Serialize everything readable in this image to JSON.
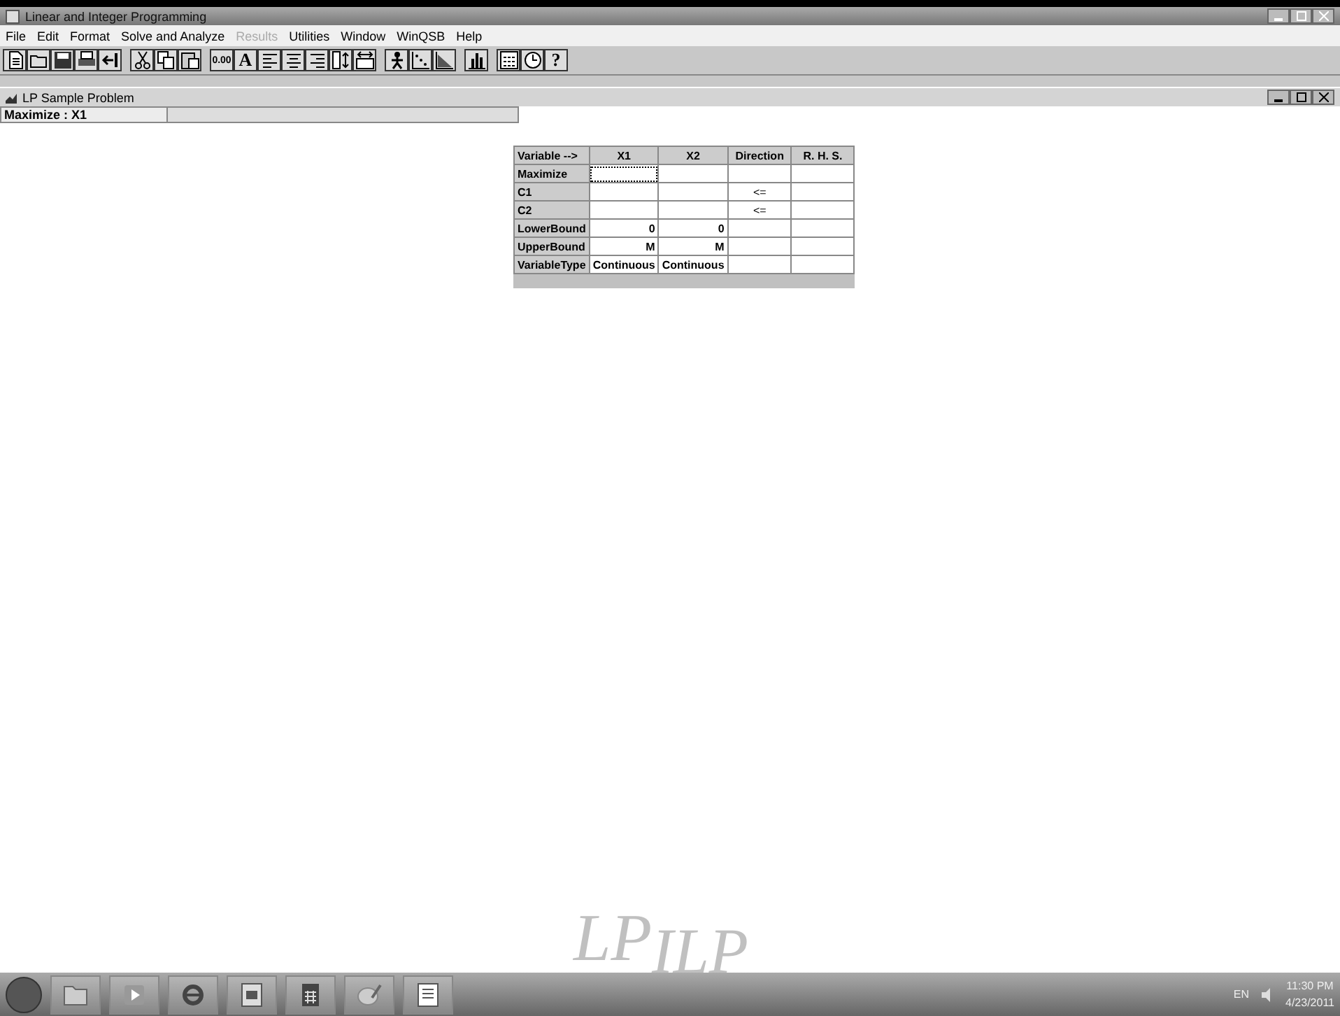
{
  "window": {
    "title": "Linear and Integer Programming"
  },
  "menu": [
    {
      "label": "File",
      "disabled": false
    },
    {
      "label": "Edit",
      "disabled": false
    },
    {
      "label": "Format",
      "disabled": false
    },
    {
      "label": "Solve and Analyze",
      "disabled": false
    },
    {
      "label": "Results",
      "disabled": true
    },
    {
      "label": "Utilities",
      "disabled": false
    },
    {
      "label": "Window",
      "disabled": false
    },
    {
      "label": "WinQSB",
      "disabled": false
    },
    {
      "label": "Help",
      "disabled": false
    }
  ],
  "toolbar": [
    [
      {
        "kind": "new"
      },
      {
        "kind": "open"
      },
      {
        "kind": "save"
      },
      {
        "kind": "print"
      },
      {
        "kind": "exit"
      }
    ],
    [
      {
        "kind": "cut"
      },
      {
        "kind": "copy"
      },
      {
        "kind": "paste"
      }
    ],
    [
      {
        "kind": "text",
        "label": "0.00"
      },
      {
        "kind": "font",
        "label": "A"
      },
      {
        "kind": "left"
      },
      {
        "kind": "center"
      },
      {
        "kind": "right"
      },
      {
        "kind": "height"
      },
      {
        "kind": "width"
      }
    ],
    [
      {
        "kind": "solve"
      },
      {
        "kind": "points"
      },
      {
        "kind": "area"
      }
    ],
    [
      {
        "kind": "bars"
      }
    ],
    [
      {
        "kind": "calc"
      },
      {
        "kind": "clock"
      },
      {
        "kind": "help",
        "label": "?"
      }
    ]
  ],
  "child_window": {
    "title": "LP Sample Problem",
    "objective": "Maximize : X1"
  },
  "table": {
    "columns": [
      "Variable -->",
      "X1",
      "X2",
      "Direction",
      "R. H. S."
    ],
    "rows": [
      {
        "cells": [
          {
            "text": "Maximize",
            "selected": false
          },
          {
            "selected": true
          },
          {
            "selected": false
          },
          {
            "selected": false
          },
          {
            "selected": false
          }
        ]
      },
      {
        "cells": [
          {
            "text": "C1",
            "selected": false
          },
          {
            "selected": false
          },
          {
            "selected": false
          },
          {
            "text": "<=",
            "selected": false
          },
          {
            "selected": false
          }
        ]
      },
      {
        "cells": [
          {
            "text": "C2",
            "selected": false
          },
          {
            "selected": false
          },
          {
            "selected": false
          },
          {
            "text": "<=",
            "selected": false
          },
          {
            "selected": false
          }
        ]
      },
      {
        "cells": [
          {
            "text": "LowerBound",
            "selected": false
          },
          {
            "text": "0",
            "selected": false
          },
          {
            "text": "0",
            "selected": false
          },
          {
            "selected": false
          },
          {
            "selected": false
          }
        ]
      },
      {
        "cells": [
          {
            "text": "UpperBound",
            "selected": false
          },
          {
            "text": "M",
            "selected": false
          },
          {
            "text": "M",
            "selected": false
          },
          {
            "selected": false
          },
          {
            "selected": false
          }
        ]
      },
      {
        "cells": [
          {
            "text": "VariableType",
            "selected": false
          },
          {
            "text": "Continuous",
            "selected": false
          },
          {
            "text": "Continuous",
            "selected": false
          },
          {
            "selected": false
          },
          {
            "selected": false
          }
        ]
      }
    ]
  },
  "logo": {
    "main": "LP",
    "sub": "ILP"
  },
  "taskbar": {
    "apps": [
      {
        "kind": "folder"
      },
      {
        "kind": "media"
      },
      {
        "kind": "browser"
      },
      {
        "kind": "doc"
      },
      {
        "kind": "calc"
      },
      {
        "kind": "paint"
      },
      {
        "kind": "word"
      }
    ],
    "language": "EN",
    "time": "11:30 PM",
    "date": "4/23/2011"
  }
}
